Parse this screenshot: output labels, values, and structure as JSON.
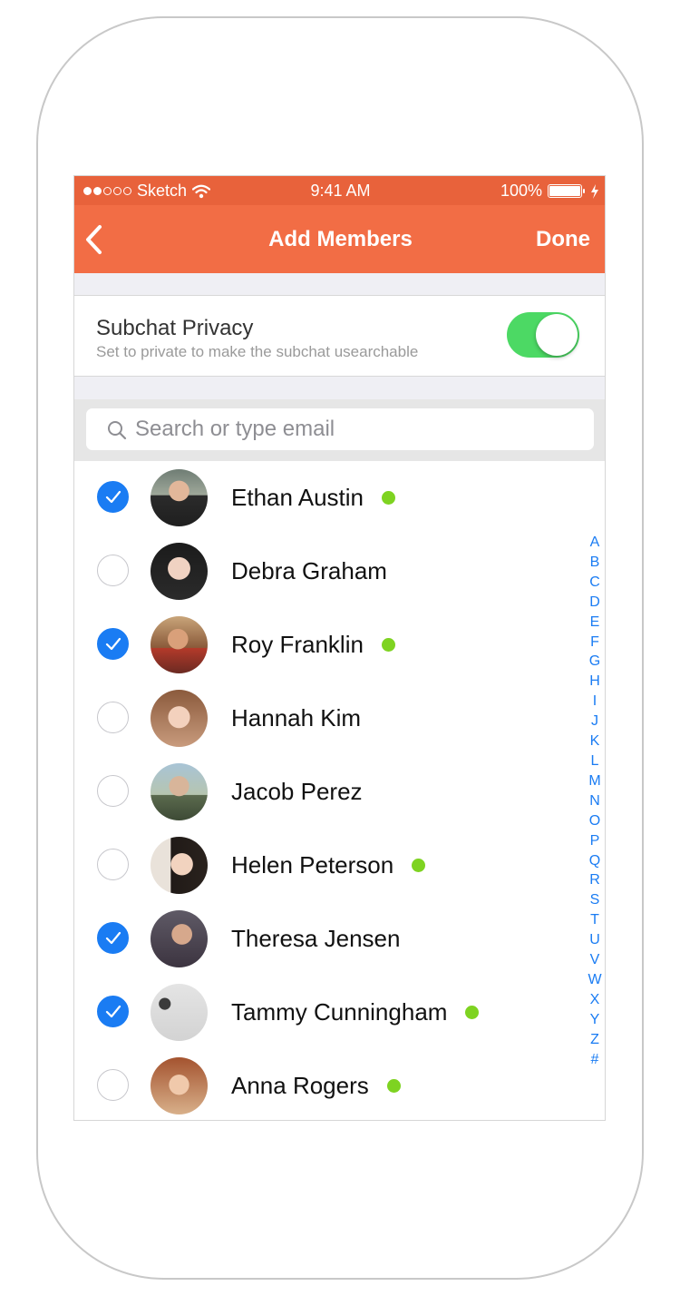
{
  "status_bar": {
    "carrier": "Sketch",
    "time": "9:41 AM",
    "battery": "100%"
  },
  "nav": {
    "title": "Add Members",
    "done_label": "Done"
  },
  "privacy": {
    "title": "Subchat Privacy",
    "subtitle": "Set to private to make the subchat usearchable",
    "toggle_on": true
  },
  "search": {
    "placeholder": "Search or type email"
  },
  "colors": {
    "accent_orange": "#f26d45",
    "status_orange": "#e8623b",
    "check_blue": "#1a7cf3",
    "online_green": "#7ed321",
    "toggle_green": "#4cd964"
  },
  "contacts": [
    {
      "name": "Ethan Austin",
      "selected": true,
      "online": true
    },
    {
      "name": "Debra Graham",
      "selected": false,
      "online": false
    },
    {
      "name": "Roy Franklin",
      "selected": true,
      "online": true
    },
    {
      "name": "Hannah Kim",
      "selected": false,
      "online": false
    },
    {
      "name": "Jacob Perez",
      "selected": false,
      "online": false
    },
    {
      "name": "Helen Peterson",
      "selected": false,
      "online": true
    },
    {
      "name": "Theresa Jensen",
      "selected": true,
      "online": false
    },
    {
      "name": "Tammy Cunningham",
      "selected": true,
      "online": true
    },
    {
      "name": "Anna Rogers",
      "selected": false,
      "online": true
    }
  ],
  "alphabet": [
    "A",
    "B",
    "C",
    "D",
    "E",
    "F",
    "G",
    "H",
    "I",
    "J",
    "K",
    "L",
    "M",
    "N",
    "O",
    "P",
    "Q",
    "R",
    "S",
    "T",
    "U",
    "V",
    "W",
    "X",
    "Y",
    "Z",
    "#"
  ]
}
